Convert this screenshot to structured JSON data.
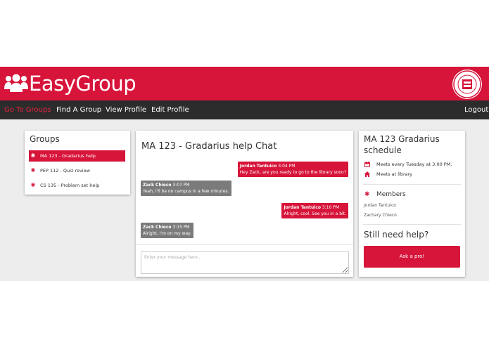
{
  "app": {
    "name": "EasyGroup"
  },
  "colors": {
    "brand": "#d7143a",
    "nav_bg": "#2c2c2c",
    "active_nav": "#e8213f",
    "other_msg": "#7b7b7b",
    "page_bg": "#ededed"
  },
  "nav": {
    "items": [
      "Go To Groups",
      "Find A Group",
      "View Profile",
      "Edit Profile"
    ],
    "active": "Go To Groups",
    "logout": "Logout"
  },
  "groups": {
    "title": "Groups",
    "items": [
      {
        "label": "MA 123 - Gradarius help",
        "active": true,
        "icon": "asterisk-icon"
      },
      {
        "label": "PEP 112 - Quiz review",
        "active": false,
        "icon": "asterisk-icon"
      },
      {
        "label": "CS 135 - Problem set help",
        "active": false,
        "icon": "asterisk-icon"
      }
    ]
  },
  "chat": {
    "title": "MA 123 - Gradarius help Chat",
    "messages": [
      {
        "author": "Jordan Tantuico",
        "time": "3:04 PM",
        "text": "Hey Zack, are you ready to go to the library soon?",
        "side": "right"
      },
      {
        "author": "Zack Chieco",
        "time": "3:07 PM",
        "text": "Yeah, I'll be on campus in a few minutes.",
        "side": "left"
      },
      {
        "author": "Jordan Tantuico",
        "time": "3:10 PM",
        "text": "Alright, cool. See you in a bit.",
        "side": "right"
      },
      {
        "author": "Zack Chieco",
        "time": "3:15 PM",
        "text": "Alright, I'm on my way.",
        "side": "left"
      }
    ],
    "input_placeholder": "Enter your message here...",
    "input_value": ""
  },
  "schedule": {
    "title": "MA 123 Gradarius schedule",
    "meeting_time": "Meets every Tuesday at 3:00 PM.",
    "meeting_place": "Meets at library",
    "members_title": "Members",
    "members": [
      "Jordan Tantuico",
      "Zachary Chieco"
    ],
    "help_title": "Still need help?",
    "help_button": "Ask a pro!"
  }
}
